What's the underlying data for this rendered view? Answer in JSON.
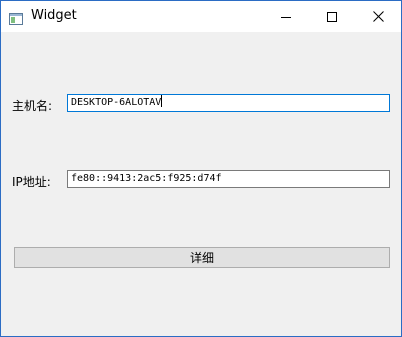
{
  "window": {
    "title": "Widget",
    "icons": {
      "app": "app-window-icon",
      "minimize": "minimize-icon",
      "maximize": "maximize-icon",
      "close": "close-icon"
    }
  },
  "form": {
    "hostname_label": "主机名:",
    "hostname_value": "DESKTOP-6ALOTAV",
    "ip_label": "IP地址:",
    "ip_value": "fe80::9413:2ac5:f925:d74f",
    "detail_button_label": "详细"
  },
  "colors": {
    "window_background": "#f0f0f0",
    "titlebar_background": "#ffffff",
    "focus_border": "#0078d7",
    "button_background": "#e1e1e1"
  }
}
